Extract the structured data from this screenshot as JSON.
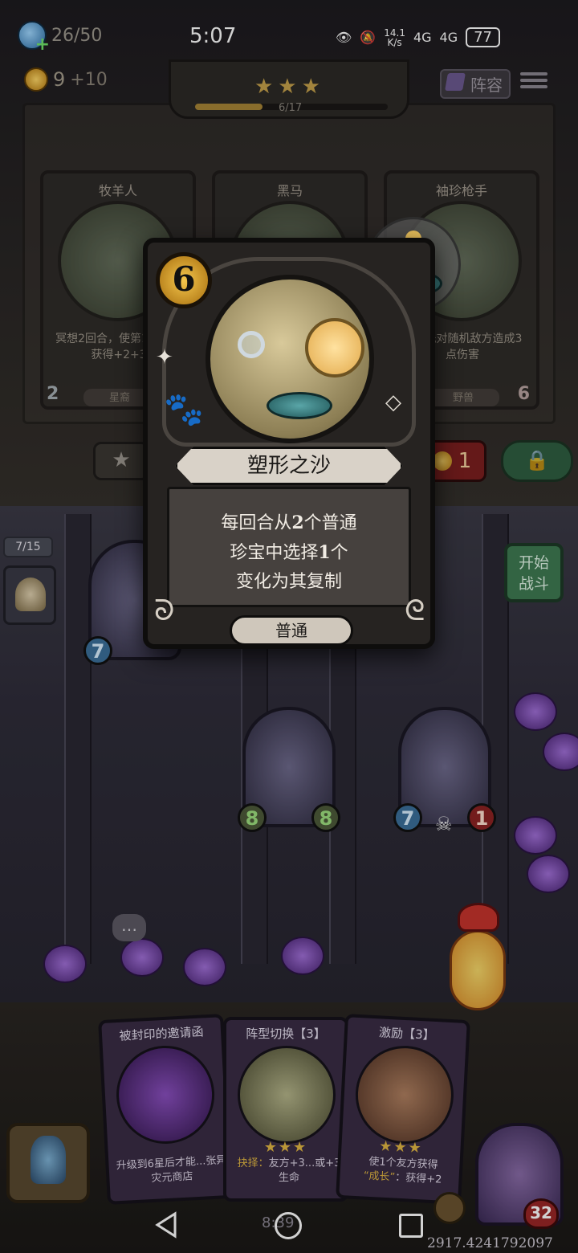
{
  "status_bar": {
    "time": "5:07",
    "net_speed_top": "14.1",
    "net_speed_bottom": "K/s",
    "signal_1": "4G",
    "signal_2": "4G",
    "battery": "77"
  },
  "hud": {
    "energy": "26/50",
    "gold": "9",
    "gold_bonus": "+10",
    "lineup_label": "阵容",
    "tier_stars": "★★★",
    "tier_progress": "6/17",
    "tier_progress_fraction": 0.35
  },
  "shop": {
    "cards": [
      {
        "name": "牧羊人",
        "desc": "冥想2回合，使第1个友方获得+2+3",
        "tribe": "星裔",
        "atk": "2",
        "hp": ""
      },
      {
        "name": "黑马",
        "desc": "",
        "tribe": "",
        "atk": "",
        "hp": ""
      },
      {
        "name": "袖珍枪手",
        "desc": "时，先对随机敌方造成3点伤害",
        "tribe": "野兽",
        "atk": "",
        "hp": "6"
      }
    ],
    "refresh_cost": "1",
    "upgrade_icon": "star-arrow-icon",
    "lock_icon": "lock-icon"
  },
  "board": {
    "counter": "7/15",
    "start_battle_line1": "开始",
    "start_battle_line2": "战斗",
    "units": [
      {
        "atk": "7",
        "hp": ""
      },
      {
        "atk": "8",
        "hp": "8"
      },
      {
        "atk": "7",
        "hp": "1"
      }
    ]
  },
  "hand": [
    {
      "title": "被封印的邀请函",
      "stars": "",
      "desc": "升级到6星后才能...张异灾元商店"
    },
    {
      "title": "阵型切换【3】",
      "stars": "★★★",
      "desc_prefix": "抉择：",
      "desc": "友方+3...或+3生命"
    },
    {
      "title": "激励【3】",
      "stars": "★★★",
      "desc_prefix": "",
      "desc": "使1个友方获得",
      "desc2_prefix": "“成长”",
      "desc2": "：获得+2"
    }
  ],
  "bottom": {
    "hero_hp": "32",
    "timer": "8:39",
    "uid": "2917.4241792097"
  },
  "popup": {
    "cost": "6",
    "name": "塑形之沙",
    "desc_line1_a": "每回合从",
    "desc_line1_num": "2",
    "desc_line1_b": "个普通",
    "desc_line2_a": "珍宝中选择",
    "desc_line2_num": "1",
    "desc_line2_b": "个",
    "desc_line3": "变化为其复制",
    "rarity": "普通"
  },
  "colors": {
    "gold": "#c6a24b",
    "start_green": "#3f7a52",
    "refresh_red": "#7c1f1f"
  }
}
